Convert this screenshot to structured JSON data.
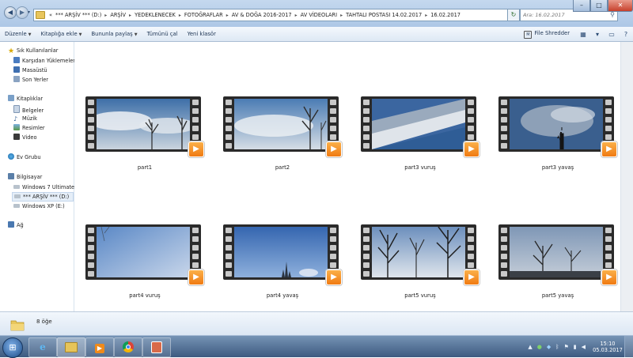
{
  "address_bar": {
    "segments": [
      "*** ARŞİV *** (D:)",
      "ARŞİV",
      "YEDEKLENECEK",
      "FOTOĞRAFLAR",
      "AV & DOĞA 2016-2017",
      "AV VİDEOLARI",
      "TAHTALI POSTASI 14.02.2017",
      "16.02.2017"
    ],
    "overflow_glyph": "«"
  },
  "search": {
    "placeholder": "Ara: 16.02.2017"
  },
  "command_bar": {
    "organize": "Düzenle",
    "add_to_library": "Kitaplığa ekle",
    "share_with": "Bununla paylaş",
    "play_all": "Tümünü çal",
    "new_folder": "Yeni klasör",
    "file_shredder": "File Shredder"
  },
  "navigation": {
    "favorites": {
      "label": "Sık Kullanılanlar",
      "items": [
        "Karşıdan Yüklemeler",
        "Masaüstü",
        "Son Yerler"
      ]
    },
    "libraries": {
      "label": "Kitaplıklar",
      "items": [
        "Belgeler",
        "Müzik",
        "Resimler",
        "Video"
      ]
    },
    "homegroup": {
      "label": "Ev Grubu"
    },
    "computer": {
      "label": "Bilgisayar",
      "items": [
        "Windows 7 Ultimate",
        "*** ARŞİV *** (D:)",
        "Windows XP (E:)"
      ]
    },
    "network": {
      "label": "Ağ"
    }
  },
  "files": [
    {
      "name": "part1",
      "scene": "clouds-trees-left"
    },
    {
      "name": "part2",
      "scene": "clouds-trees-right"
    },
    {
      "name": "part3 vuruş",
      "scene": "diagonal-clouds"
    },
    {
      "name": "part3 yavaş",
      "scene": "cloudy-spire"
    },
    {
      "name": "part4 vuruş",
      "scene": "pale-sky-thin-trees"
    },
    {
      "name": "part4 yavaş",
      "scene": "blue-sky-spire"
    },
    {
      "name": "part5 vuruş",
      "scene": "bare-trees-bright"
    },
    {
      "name": "part5 yavaş",
      "scene": "bare-trees-dark"
    }
  ],
  "details": {
    "item_count": "8 öğe"
  },
  "taskbar": {
    "apps": [
      "internet-explorer",
      "windows-explorer",
      "media-player",
      "chrome",
      "calculator"
    ],
    "time": "15:10",
    "date": "05.03.2017"
  },
  "colors": {
    "taskbar": "#3d5a80",
    "play_badge": "#f07a12",
    "titlebar": "#adc7e6"
  }
}
